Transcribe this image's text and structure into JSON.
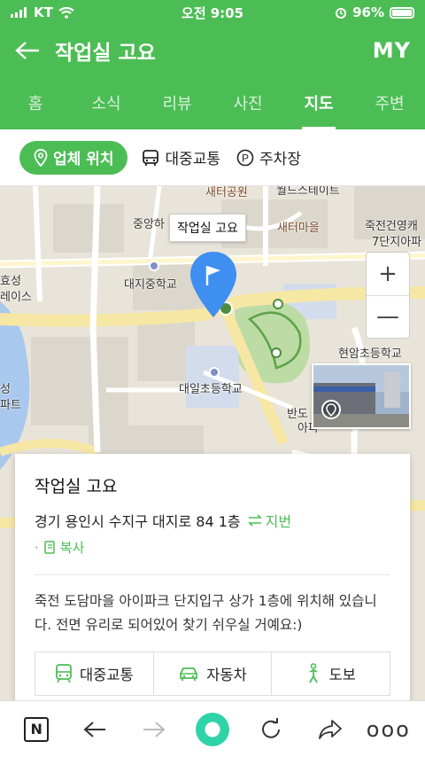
{
  "status_bar": {
    "carrier": "KT",
    "time": "오전 9:05",
    "battery": "96%"
  },
  "header": {
    "title": "작업실 고요",
    "right_label": "MY",
    "back_icon": "back-arrow-icon"
  },
  "tabs": [
    {
      "label": "홈",
      "active": false
    },
    {
      "label": "소식",
      "active": false
    },
    {
      "label": "리뷰",
      "active": false
    },
    {
      "label": "사진",
      "active": false
    },
    {
      "label": "지도",
      "active": true
    },
    {
      "label": "주변",
      "active": false
    }
  ],
  "chips": [
    {
      "label": "업체 위치",
      "icon": "location-pin-icon",
      "active": true
    },
    {
      "label": "대중교통",
      "icon": "bus-icon",
      "active": false
    },
    {
      "label": "주차장",
      "icon": "parking-icon",
      "active": false
    }
  ],
  "map": {
    "callout": "작업실 고요",
    "labels": {
      "l1": "새터공원",
      "l2": "월드스테이트",
      "l3": "중앙하",
      "l4": "새터마을",
      "l5": "죽전건영캐",
      "l6": "7단지아파",
      "l7": "대지중학교",
      "l8": "효성",
      "l9": "레이스",
      "l10": "현암초등학교",
      "l11": "대일초등학교",
      "l12": "성",
      "l13": "파트",
      "l14": "반도",
      "l15": "아파"
    },
    "zoom_in": "+",
    "zoom_out": "—"
  },
  "card": {
    "name": "작업실 고요",
    "address": "경기 용인시 수지구 대지로 84 1층",
    "jibun_label": "지번",
    "copy_label": "복사",
    "description": "죽전 도담마을 아이파크 단지입구 상가 1층에 위치해 있습니다. 전면 유리로 되어있어 찾기 쉬우실 거예요:)",
    "buttons": [
      {
        "label": "대중교통",
        "icon": "train-icon"
      },
      {
        "label": "자동차",
        "icon": "car-icon"
      },
      {
        "label": "도보",
        "icon": "walk-icon"
      }
    ]
  },
  "toolbar": {
    "n_label": "N",
    "more": "ooo"
  },
  "colors": {
    "brand_green": "#4cbd55",
    "map_bg": "#e9e4d9",
    "road": "#f7e7a4"
  }
}
